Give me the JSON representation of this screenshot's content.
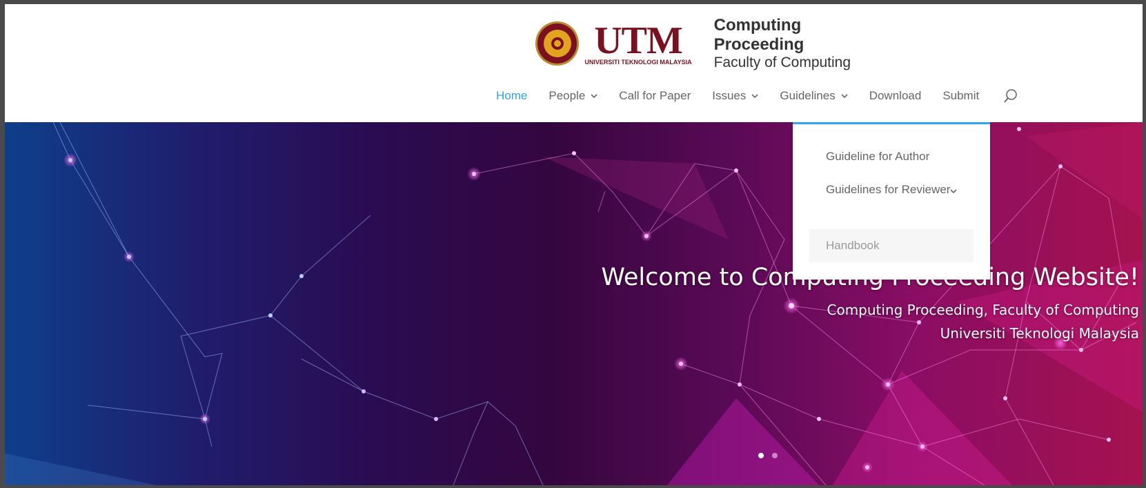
{
  "brand": {
    "utm_text": "UTM",
    "utm_subtext": "UNIVERSITI TEKNOLOGI MALAYSIA",
    "title": "Computing Proceeding",
    "subtitle": "Faculty of Computing"
  },
  "nav": {
    "items": [
      {
        "label": "Home",
        "active": true
      },
      {
        "label": "People",
        "has_submenu": true
      },
      {
        "label": "Call for Paper"
      },
      {
        "label": "Issues",
        "has_submenu": true
      },
      {
        "label": "Guidelines",
        "has_submenu": true,
        "open": true
      },
      {
        "label": "Download"
      },
      {
        "label": "Submit"
      }
    ],
    "accent_color": "#2ea3f2",
    "search_icon": "search-icon"
  },
  "dropdown": {
    "items": [
      {
        "label": "Guideline for Author"
      },
      {
        "label": "Guidelines for Reviewer",
        "has_submenu": true
      },
      {
        "label": "Handbook",
        "hovered": true
      }
    ]
  },
  "hero": {
    "title": "Welcome to Computing Proceeding Website!",
    "line1": "Computing Proceeding, Faculty of Computing",
    "line2": "Universiti Teknologi Malaysia",
    "slides": 2,
    "active_slide": 1
  }
}
